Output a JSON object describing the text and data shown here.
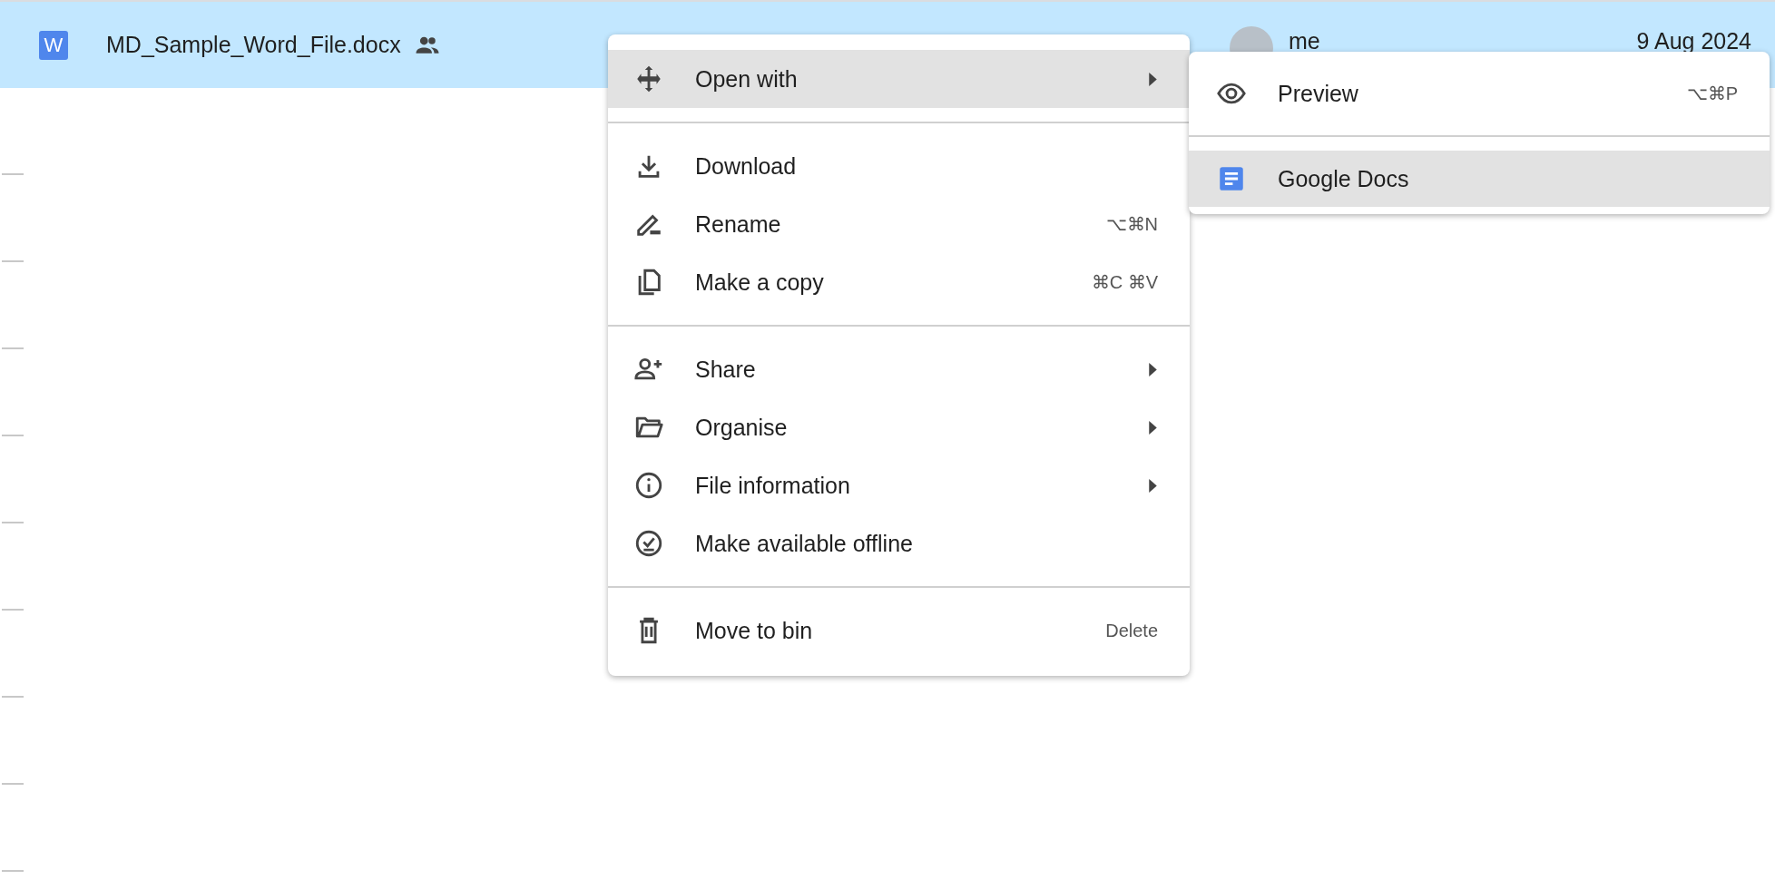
{
  "file_row": {
    "selected": true,
    "badge": "W",
    "name": "MD_Sample_Word_File.docx",
    "shared": true,
    "owner": "me",
    "modified": "9 Aug 2024"
  },
  "context_menu": {
    "groups": [
      [
        {
          "kind": "open-with",
          "label": "Open with",
          "submenu": true,
          "selected": true
        }
      ],
      [
        {
          "kind": "download",
          "label": "Download",
          "submenu": false,
          "selected": false
        },
        {
          "kind": "rename",
          "label": "Rename",
          "shortcut": "⌥⌘N",
          "submenu": false,
          "selected": false
        },
        {
          "kind": "copy",
          "label": "Make a copy",
          "shortcut": "⌘C ⌘V",
          "submenu": false,
          "selected": false
        }
      ],
      [
        {
          "kind": "share",
          "label": "Share",
          "submenu": true,
          "selected": false
        },
        {
          "kind": "organise",
          "label": "Organise",
          "submenu": true,
          "selected": false
        },
        {
          "kind": "info",
          "label": "File information",
          "submenu": true,
          "selected": false
        },
        {
          "kind": "offline",
          "label": "Make available offline",
          "submenu": false,
          "selected": false
        }
      ],
      [
        {
          "kind": "bin",
          "label": "Move to bin",
          "shortcut": "Delete",
          "submenu": false,
          "selected": false
        }
      ]
    ]
  },
  "submenu": {
    "groups": [
      [
        {
          "kind": "preview",
          "label": "Preview",
          "shortcut": "⌥⌘P",
          "selected": false
        }
      ],
      [
        {
          "kind": "docs",
          "label": "Google Docs",
          "selected": true
        }
      ]
    ]
  }
}
